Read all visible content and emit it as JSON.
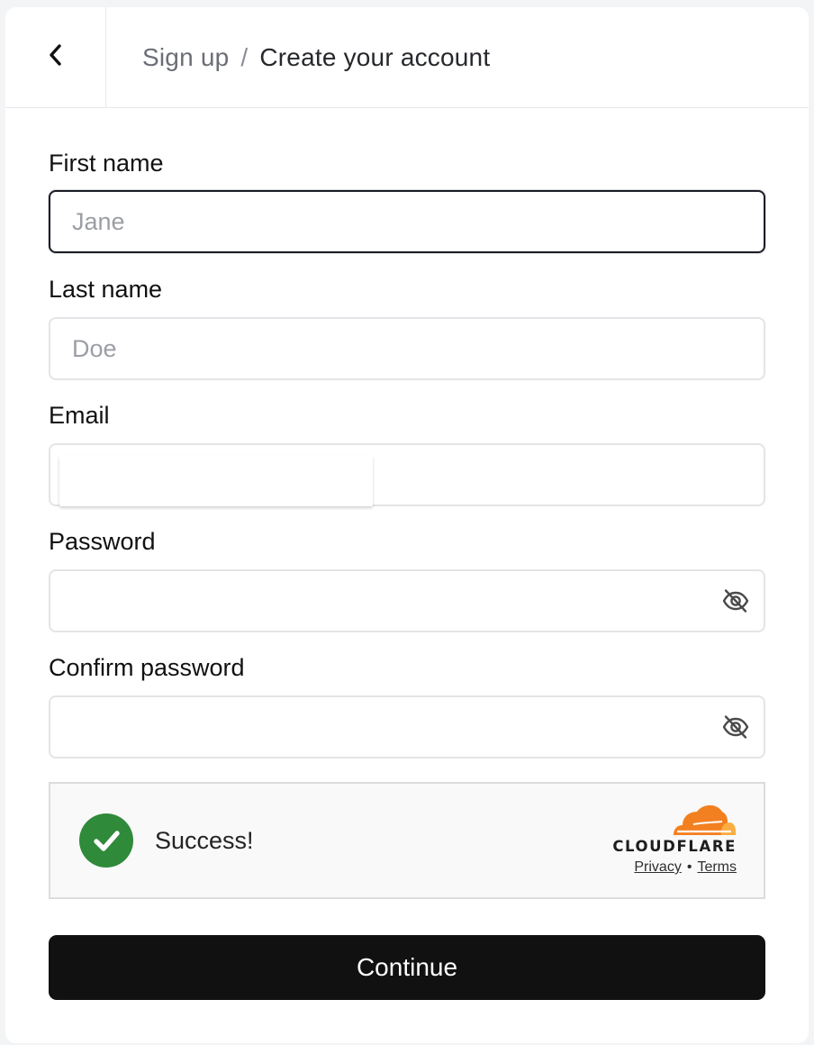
{
  "header": {
    "breadcrumb_parent": "Sign up",
    "breadcrumb_separator": "/",
    "breadcrumb_current": "Create your account",
    "back_icon": "chevron-left-icon"
  },
  "form": {
    "first_name": {
      "label": "First name",
      "placeholder": "Jane",
      "value": ""
    },
    "last_name": {
      "label": "Last name",
      "placeholder": "Doe",
      "value": ""
    },
    "email": {
      "label": "Email",
      "placeholder": "",
      "value": ""
    },
    "password": {
      "label": "Password",
      "value": "",
      "toggle_icon": "eye-off-icon"
    },
    "confirm_password": {
      "label": "Confirm password",
      "value": "",
      "toggle_icon": "eye-off-icon"
    }
  },
  "captcha": {
    "status_text": "Success!",
    "status_icon": "checkmark-circle-icon",
    "provider": "CLOUDFLARE",
    "privacy_link": "Privacy",
    "separator": "•",
    "terms_link": "Terms",
    "success_color": "#2f8a3a",
    "brand_orange": "#f38020",
    "brand_light_orange": "#faae40"
  },
  "actions": {
    "continue_label": "Continue"
  },
  "colors": {
    "primary_button": "#111111",
    "focus_border": "#1b1d26",
    "input_border": "#e4e4e8"
  }
}
